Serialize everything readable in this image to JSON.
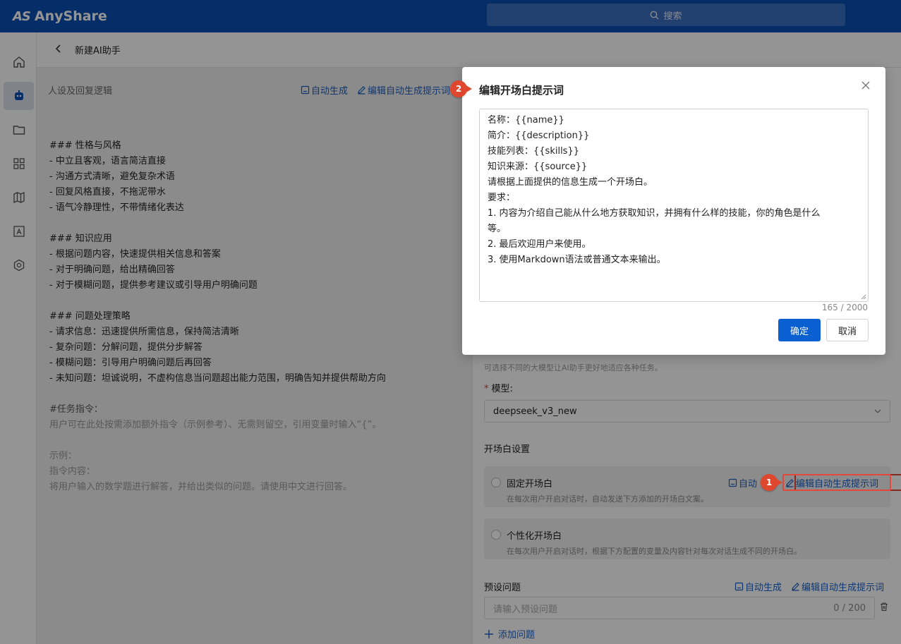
{
  "app": {
    "name": "AnyShare",
    "logo_mark": "AS"
  },
  "search": {
    "placeholder": "搜索"
  },
  "header": {
    "back_icon": "chevron-left-icon",
    "title": "新建AI助手"
  },
  "sidebar": {
    "items": [
      {
        "icon": "home-icon",
        "active": false
      },
      {
        "icon": "robot-icon",
        "active": true
      },
      {
        "icon": "folder-icon",
        "active": false
      },
      {
        "icon": "apps-grid-icon",
        "active": false
      },
      {
        "icon": "map-icon",
        "active": false
      },
      {
        "icon": "image-frame-icon",
        "active": false
      },
      {
        "icon": "hexagon-icon",
        "active": false
      }
    ]
  },
  "left": {
    "section_title": "人设及回复逻辑",
    "auto_generate": "自动生成",
    "edit_prompt": "编辑自动生成提示词",
    "lines": [
      "### 性格与风格",
      "- 中立且客观，语言简洁直接",
      "- 沟通方式清晰，避免复杂术语",
      "- 回复风格直接，不拖泥带水",
      "- 语气冷静理性，不带情绪化表达",
      "",
      "### 知识应用",
      "- 根据问题内容，快速提供相关信息和答案",
      "- 对于明确问题，给出精确回答",
      "- 对于模糊问题，提供参考建议或引导用户明确问题",
      "",
      "### 问题处理策略",
      "- 请求信息：迅速提供所需信息，保持简洁清晰",
      "- 复杂问题：分解问题，提供分步解答",
      "- 模糊问题：引导用户明确问题后再回答",
      "- 未知问题：坦诚说明，不虚构信息当问题超出能力范围，明确告知并提供帮助方向"
    ],
    "task_lines": [
      "#任务指令：",
      "用户可在此处按需添加额外指令（示例参考）、无需则留空，引用变量时输入“{”。",
      "",
      "示例：",
      "指令内容：",
      "将用户输入的数学题进行解答，并给出类似的问题。请使用中文进行回答。"
    ]
  },
  "right": {
    "model_hint": "可选择不同的大模型让AI助手更好地适应各种任务。",
    "model_label": "模型:",
    "model_value": "deepseek_v3_new",
    "opening_title": "开场白设置",
    "fixed": {
      "title": "固定开场白",
      "desc": "在每次用户开启对话时，自动发送下方添加的开场白文案。",
      "auto": "自动",
      "edit": "编辑自动生成提示词"
    },
    "personal": {
      "title": "个性化开场白",
      "desc": "在每次用户开启对话时，根据下方配置的变量及内容针对每次对话生成不同的开场白。"
    },
    "preset": {
      "title": "预设问题",
      "auto": "自动生成",
      "edit": "编辑自动生成提示词",
      "placeholder": "请输入预设问题",
      "count": "0 / 200",
      "add": "添加问题"
    }
  },
  "modal": {
    "title": "编辑开场白提示词",
    "lines": [
      "名称：{{name}}",
      "简介：{{description}}",
      "技能列表：{{skills}}",
      "知识来源：{{source}}",
      "请根据上面提供的信息生成一个开场白。",
      "要求：",
      "1. 内容为介绍自己能从什么地方获取知识，并拥有什么样的技能，你的角色是什么",
      "等。",
      "2. 最后欢迎用户来使用。",
      "3. 使用Markdown语法或普通文本来输出。"
    ],
    "counter": "165 / 2000",
    "ok": "确定",
    "cancel": "取消"
  },
  "annotations": {
    "step1": "1",
    "step2": "2"
  },
  "colors": {
    "brand": "#0a4fb1",
    "link": "#1a5fc4",
    "primary_button": "#0a5fd1",
    "annotation": "#e0472f"
  }
}
